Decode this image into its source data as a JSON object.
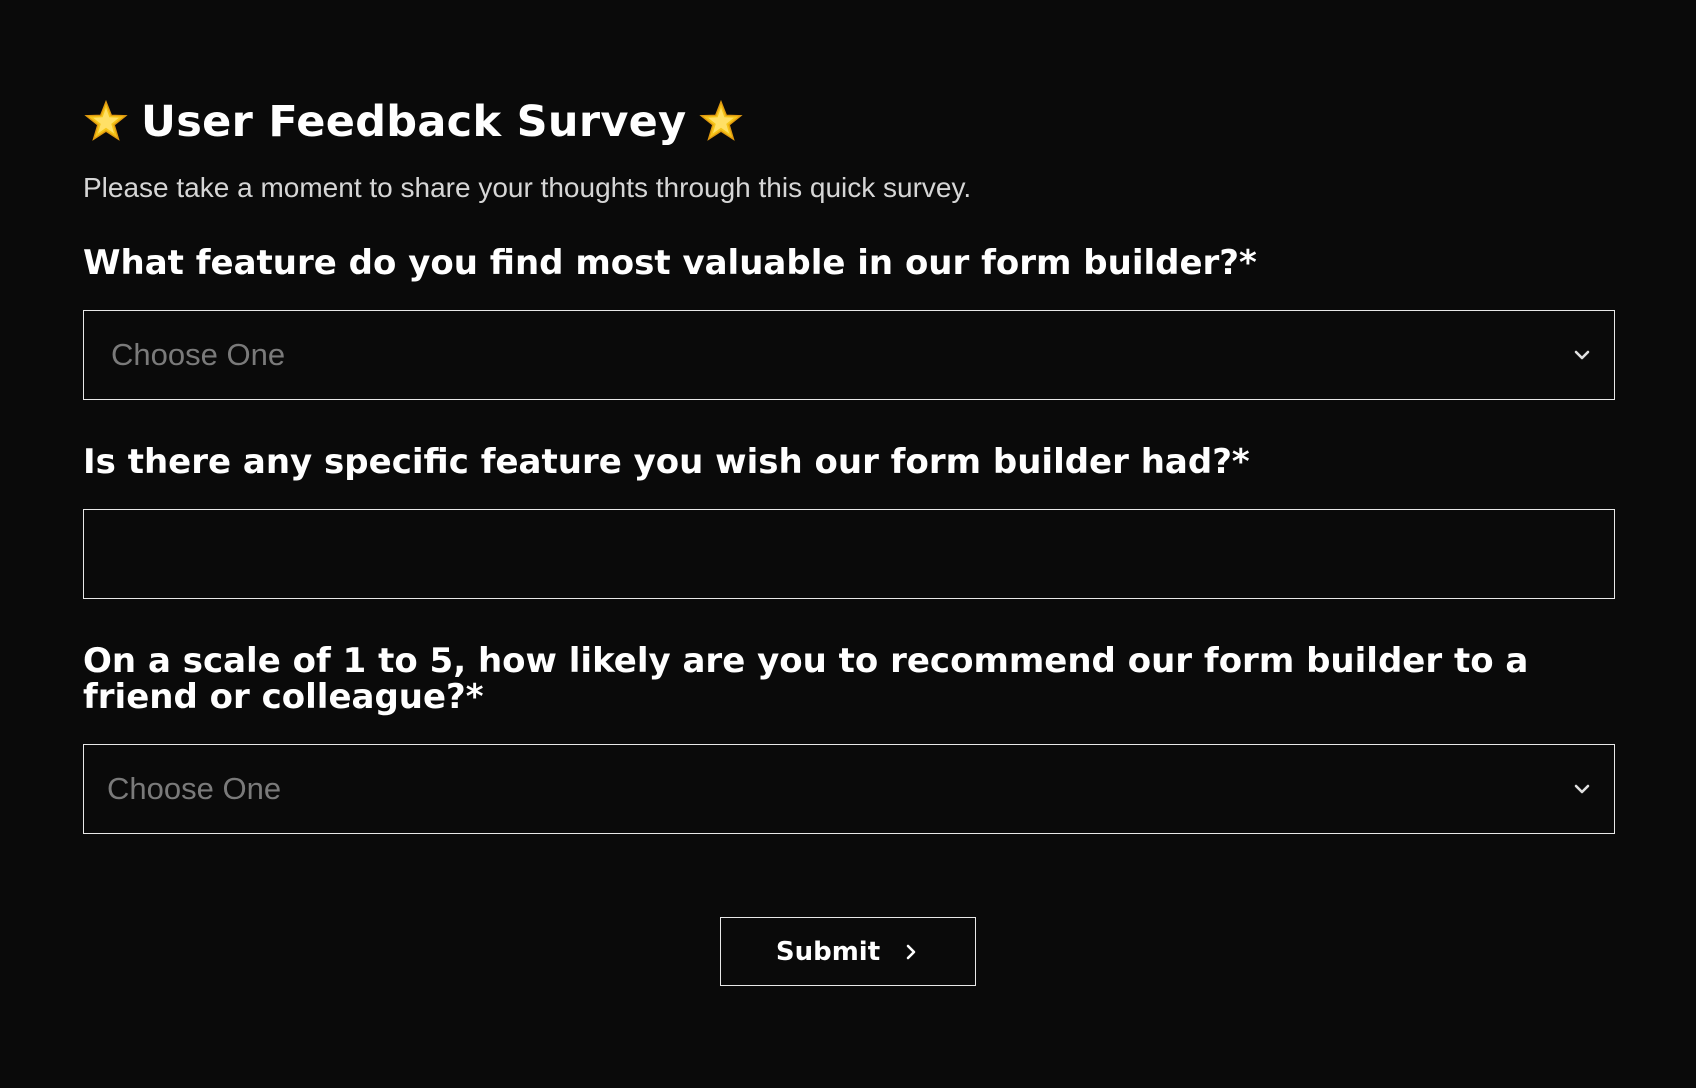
{
  "survey": {
    "title": "User Feedback Survey",
    "subtitle": "Please take a moment to share your thoughts through this quick survey.",
    "title_icons": [
      "star-icon",
      "star-icon"
    ]
  },
  "questions": [
    {
      "label": "What feature do you find most valuable in our form builder?*",
      "type": "select",
      "placeholder": "Choose One",
      "icon": "chevron-down-icon"
    },
    {
      "label": "Is there any specific feature you wish our form builder had?*",
      "type": "text",
      "value": ""
    },
    {
      "label": "On a scale of 1 to 5, how likely are you to recommend our form builder to a friend or colleague?*",
      "type": "select",
      "placeholder": "Choose One",
      "icon": "chevron-down-icon"
    }
  ],
  "submit": {
    "label": "Submit",
    "icon": "chevron-right-icon"
  },
  "colors": {
    "background": "#0a0a0a",
    "text": "#ffffff",
    "subtitle": "#d6d6d6",
    "placeholder": "#7a7a7a",
    "border": "#e8e8e8",
    "star": "#f5c518"
  }
}
